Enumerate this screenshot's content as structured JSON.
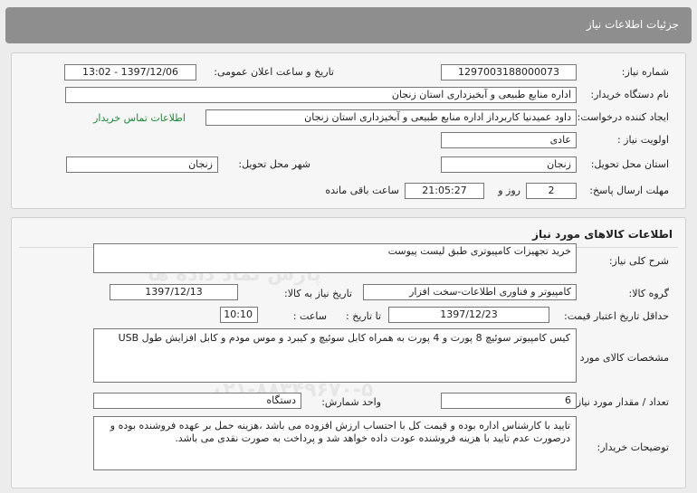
{
  "header": {
    "title": "جزئیات اطلاعات نیاز"
  },
  "need_info": {
    "need_number_label": "شماره نیاز:",
    "need_number": "1297003188000073",
    "announce_label": "تاریخ و ساعت اعلان عمومی:",
    "announce_value": "1397/12/06 - 13:02",
    "buyer_org_label": "نام دستگاه خریدار:",
    "buyer_org": "اداره منابع طبیعی و آبخیزداری استان زنجان",
    "requester_label": "ایجاد کننده درخواست:",
    "requester": "داود عمیدنیا کاربرداز  اداره منابع طبیعی و آبخیزداری استان زنجان",
    "contact_link": "اطلاعات تماس خریدار",
    "priority_label": "اولویت نیاز :",
    "priority": "عادی",
    "province_label": "استان محل تحویل:",
    "province": "زنجان",
    "city_label": "شهر محل تحویل:",
    "city": "زنجان",
    "deadline_label": "مهلت ارسال پاسخ:",
    "deadline_days": "2",
    "days_word": "روز و",
    "deadline_time": "21:05:27",
    "remaining_word": "ساعت باقی مانده"
  },
  "goods_info": {
    "title": "اطلاعات کالاهای مورد نیاز",
    "summary_label": "شرح کلی نیاز:",
    "summary": "خرید تجهیزات کامپیوتری طبق لیست پیوست",
    "group_label": "گروه کالا:",
    "group": "کامپیوتر و فناوری اطلاعات-سخت افزار",
    "need_date_label": "تاریخ نیاز به کالا:",
    "need_date": "1397/12/13",
    "validity_label": "حداقل تاریخ اعتبار قیمت:",
    "until_label": "تا تاریخ :",
    "validity_date": "1397/12/23",
    "hour_label": "ساعت :",
    "validity_time": "10:10",
    "spec_label": "مشخصات کالای مورد نیاز:",
    "spec": "کیس کامپیوتر سوئیچ 8 پورت و 4 پورت به همراه کابل سوئیچ و کیبرد و موس مودم و کابل افزایش طول USB",
    "qty_label": "تعداد / مقدار مورد نیاز:",
    "qty": "6",
    "unit_label": "واحد شمارش:",
    "unit": "دستگاه",
    "notes_label": "توضیحات خریدار:",
    "notes": "تایید با کارشناس اداره بوده و قیمت کل با احتساب ارزش افزوده می باشد ،هزینه حمل بر عهده فروشنده بوده و درصورت عدم تایید با هزینه فروشنده عودت داده خواهد شد و پرداخت به صورت نقدی می باشد."
  },
  "watermark": {
    "line1": "پارس نماد داده ها",
    "line2": "پایگاه اطلاع رسانی مناقصه و مزایده",
    "line3": "۰۲۱-۸۸۳۴۹۶۷۰-۵"
  }
}
